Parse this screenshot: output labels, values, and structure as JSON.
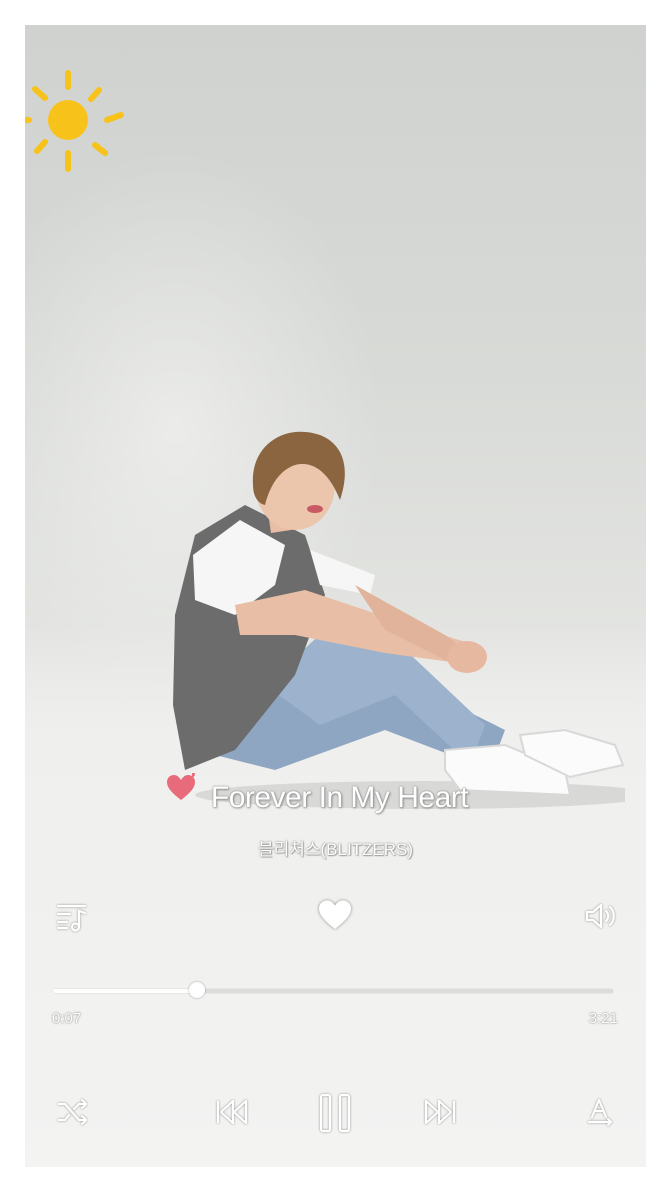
{
  "player": {
    "song_title": "Forever In My Heart",
    "artist": "블리처스(BLITZERS)",
    "liked": true,
    "progress_fraction": 0.257
  },
  "time": {
    "current": "0:07",
    "total": "3:21"
  },
  "icons": {
    "top_left": "sun-icon",
    "title_decor": "heart-icon",
    "playlist": "playlist-icon",
    "like": "heart-icon",
    "volume": "speaker-icon",
    "shuffle": "shuffle-icon",
    "previous": "skip-previous-icon",
    "pause": "pause-icon",
    "next": "skip-next-icon",
    "lyrics": "lyrics-icon"
  },
  "colors": {
    "sun": "#f7c31a",
    "title_heart": "#e86b7c",
    "ui_white": "#ffffff"
  }
}
